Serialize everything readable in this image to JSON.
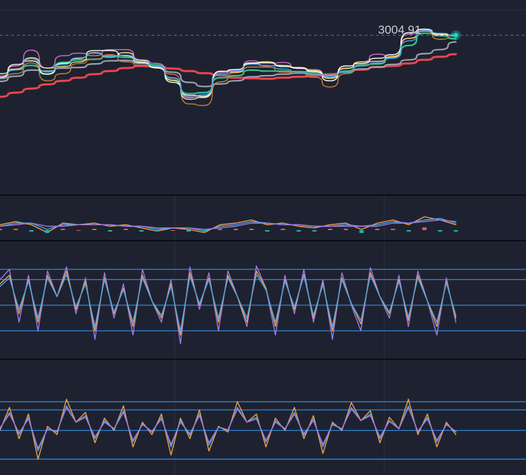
{
  "chart_data": {
    "type": "line",
    "last_price_label": "3004.91",
    "grid": true,
    "colors": {
      "background": "#1e2230",
      "divider": "#0b0d12",
      "grid": "#2a3040",
      "level_line": "#2f86d6",
      "price_dash": "#3c8a8a",
      "last_dot": "#1cd6b8"
    },
    "panels": [
      {
        "name": "price",
        "ylim": [
          2800,
          3060
        ],
        "series": [
          {
            "color": "#e8454f",
            "values": [
              2885,
              2893,
              2901,
              2909,
              2916,
              2922,
              2929,
              2935,
              2941,
              2945,
              2944,
              2940,
              2935,
              2931,
              2927,
              2922,
              2921,
              2920,
              2922,
              2924,
              2926,
              2929,
              2934,
              2938,
              2943,
              2945,
              2950,
              2957,
              2963,
              2968
            ]
          },
          {
            "color": "#9aa0ad",
            "values": [
              2915,
              2925,
              2937,
              2935,
              2941,
              2942,
              2949,
              2955,
              2956,
              2950,
              2943,
              2933,
              2913,
              2905,
              2910,
              2916,
              2924,
              2926,
              2929,
              2931,
              2929,
              2927,
              2933,
              2939,
              2943,
              2948,
              2957,
              2969,
              2977,
              2992
            ]
          },
          {
            "color": "#2ec58b",
            "values": [
              2925,
              2938,
              2946,
              2929,
              2952,
              2957,
              2958,
              2965,
              2962,
              2953,
              2947,
              2917,
              2891,
              2893,
              2922,
              2926,
              2937,
              2935,
              2935,
              2934,
              2933,
              2925,
              2935,
              2947,
              2949,
              2961,
              2985,
              3009,
              3004,
              2998
            ]
          },
          {
            "color": "#c87f3c",
            "values": [
              2920,
              2930,
              2951,
              2916,
              2930,
              2950,
              2958,
              2967,
              2953,
              2946,
              2942,
              2929,
              2871,
              2868,
              2914,
              2932,
              2943,
              2943,
              2933,
              2931,
              2923,
              2904,
              2930,
              2946,
              2950,
              2964,
              2999,
              3014,
              2997,
              3004
            ]
          },
          {
            "color": "#d46fd4",
            "values": [
              2924,
              2945,
              2976,
              2941,
              2965,
              2970,
              2965,
              2977,
              2977,
              2957,
              2950,
              2921,
              2885,
              2883,
              2931,
              2937,
              2955,
              2945,
              2952,
              2940,
              2938,
              2922,
              2941,
              2953,
              2968,
              2962,
              3007,
              3016,
              3005,
              3006
            ]
          },
          {
            "color": "#f4e27a",
            "values": [
              2930,
              2939,
              2961,
              2941,
              2944,
              2953,
              2971,
              2962,
              2971,
              2956,
              2941,
              2917,
              2880,
              2884,
              2935,
              2933,
              2950,
              2951,
              2946,
              2942,
              2936,
              2921,
              2940,
              2953,
              2954,
              2963,
              2999,
              3013,
              3005,
              3005
            ]
          },
          {
            "color": "#ffffff",
            "values": [
              2922,
              2948,
              2955,
              2929,
              2950,
              2960,
              2975,
              2975,
              2965,
              2952,
              2942,
              2913,
              2888,
              2886,
              2934,
              2938,
              2951,
              2953,
              2944,
              2941,
              2934,
              2916,
              2945,
              2950,
              2960,
              2967,
              3010,
              3017,
              3007,
              3005
            ]
          },
          {
            "color": "#4aa3df",
            "values": [
              2921,
              2937,
              2959,
              2933,
              2948,
              2961,
              2970,
              2963,
              2966,
              2954,
              2944,
              2922,
              2883,
              2889,
              2928,
              2935,
              2948,
              2946,
              2939,
              2933,
              2930,
              2925,
              2933,
              2945,
              2951,
              2960,
              2994,
              3014,
              3009,
              3005
            ]
          }
        ]
      },
      {
        "name": "macd",
        "ylim": [
          -1,
          1
        ],
        "levels": [],
        "series": [
          {
            "color": "#f0a050",
            "values": [
              0.1,
              0.3,
              0.1,
              -0.4,
              0.2,
              0.1,
              0.2,
              0.0,
              0.1,
              -0.1,
              -0.3,
              -0.1,
              -0.2,
              -0.4,
              0.1,
              0.2,
              0.4,
              0.1,
              0.2,
              0.0,
              -0.1,
              0.1,
              0.2,
              -0.2,
              0.2,
              0.4,
              0.1,
              0.6,
              0.4,
              0.1
            ]
          },
          {
            "color": "#4aa3df",
            "values": [
              0.0,
              0.2,
              0.2,
              -0.2,
              0.1,
              0.1,
              0.1,
              0.1,
              0.0,
              0.0,
              -0.2,
              -0.1,
              -0.1,
              -0.3,
              0.0,
              0.1,
              0.3,
              0.2,
              0.1,
              0.1,
              0.0,
              0.0,
              0.1,
              0.0,
              0.1,
              0.3,
              0.2,
              0.4,
              0.5,
              0.2
            ]
          },
          {
            "color": "#a07ae0",
            "values": [
              0.0,
              0.1,
              0.2,
              0.0,
              0.0,
              0.1,
              0.1,
              0.1,
              0.0,
              0.0,
              -0.1,
              -0.1,
              -0.1,
              -0.2,
              -0.1,
              0.0,
              0.2,
              0.2,
              0.1,
              0.1,
              0.0,
              0.0,
              0.0,
              0.0,
              0.0,
              0.2,
              0.2,
              0.3,
              0.4,
              0.3
            ]
          }
        ]
      },
      {
        "name": "kdj",
        "ylim": [
          -10,
          110
        ],
        "levels": [
          20,
          50,
          80,
          92
        ],
        "series": [
          {
            "color": "#9b7ae6",
            "values": [
              80,
              92,
              30,
              85,
              20,
              90,
              60,
              95,
              40,
              82,
              10,
              88,
              35,
              75,
              15,
              92,
              55,
              30,
              80,
              5,
              95,
              45,
              88,
              20,
              90,
              60,
              25,
              96,
              70,
              15,
              85,
              40,
              92,
              30,
              80,
              10,
              88,
              50,
              20,
              94,
              60,
              35,
              85,
              25,
              90,
              55,
              15,
              82,
              30
            ]
          },
          {
            "color": "#f0a050",
            "values": [
              75,
              85,
              40,
              80,
              30,
              85,
              60,
              90,
              45,
              78,
              20,
              82,
              40,
              70,
              25,
              85,
              55,
              35,
              75,
              15,
              88,
              50,
              82,
              30,
              85,
              60,
              30,
              90,
              70,
              25,
              80,
              45,
              86,
              35,
              76,
              20,
              82,
              52,
              28,
              88,
              60,
              40,
              80,
              32,
              85,
              55,
              25,
              78,
              35
            ]
          },
          {
            "color": "#4aa3df",
            "values": [
              72,
              82,
              45,
              78,
              35,
              82,
              60,
              86,
              48,
              75,
              25,
              80,
              42,
              68,
              30,
              82,
              55,
              38,
              72,
              20,
              84,
              52,
              80,
              35,
              82,
              60,
              35,
              86,
              68,
              30,
              78,
              48,
              84,
              38,
              74,
              25,
              80,
              52,
              32,
              85,
              60,
              42,
              78,
              36,
              82,
              55,
              30,
              76,
              38
            ]
          }
        ]
      },
      {
        "name": "rsi",
        "ylim": [
          0,
          100
        ],
        "levels": [
          15,
          50,
          75,
          85
        ],
        "series": [
          {
            "color": "#f0a050",
            "values": [
              50,
              78,
              40,
              70,
              15,
              55,
              45,
              88,
              60,
              72,
              35,
              65,
              50,
              80,
              30,
              60,
              45,
              70,
              20,
              65,
              40,
              75,
              25,
              55,
              48,
              85,
              60,
              70,
              30,
              65,
              50,
              78,
              40,
              68,
              22,
              60,
              50,
              84,
              62,
              74,
              35,
              66,
              52,
              88,
              45,
              70,
              30,
              60,
              45
            ]
          },
          {
            "color": "#4aa3df",
            "values": [
              52,
              72,
              45,
              66,
              25,
              52,
              48,
              80,
              60,
              68,
              40,
              62,
              52,
              74,
              36,
              58,
              48,
              66,
              30,
              62,
              44,
              70,
              32,
              54,
              50,
              78,
              60,
              66,
              36,
              62,
              52,
              72,
              44,
              64,
              30,
              58,
              52,
              78,
              62,
              70,
              40,
              62,
              52,
              80,
              48,
              66,
              36,
              58,
              48
            ]
          },
          {
            "color": "#a07ae0",
            "values": [
              53,
              70,
              47,
              64,
              28,
              52,
              49,
              78,
              60,
              66,
              42,
              60,
              52,
              72,
              38,
              57,
              49,
              64,
              33,
              60,
              46,
              68,
              35,
              54,
              51,
              76,
              60,
              64,
              38,
              60,
              52,
              70,
              46,
              62,
              33,
              57,
              52,
              76,
              62,
              68,
              42,
              61,
              52,
              78,
              49,
              64,
              38,
              57,
              49
            ]
          }
        ]
      }
    ]
  }
}
